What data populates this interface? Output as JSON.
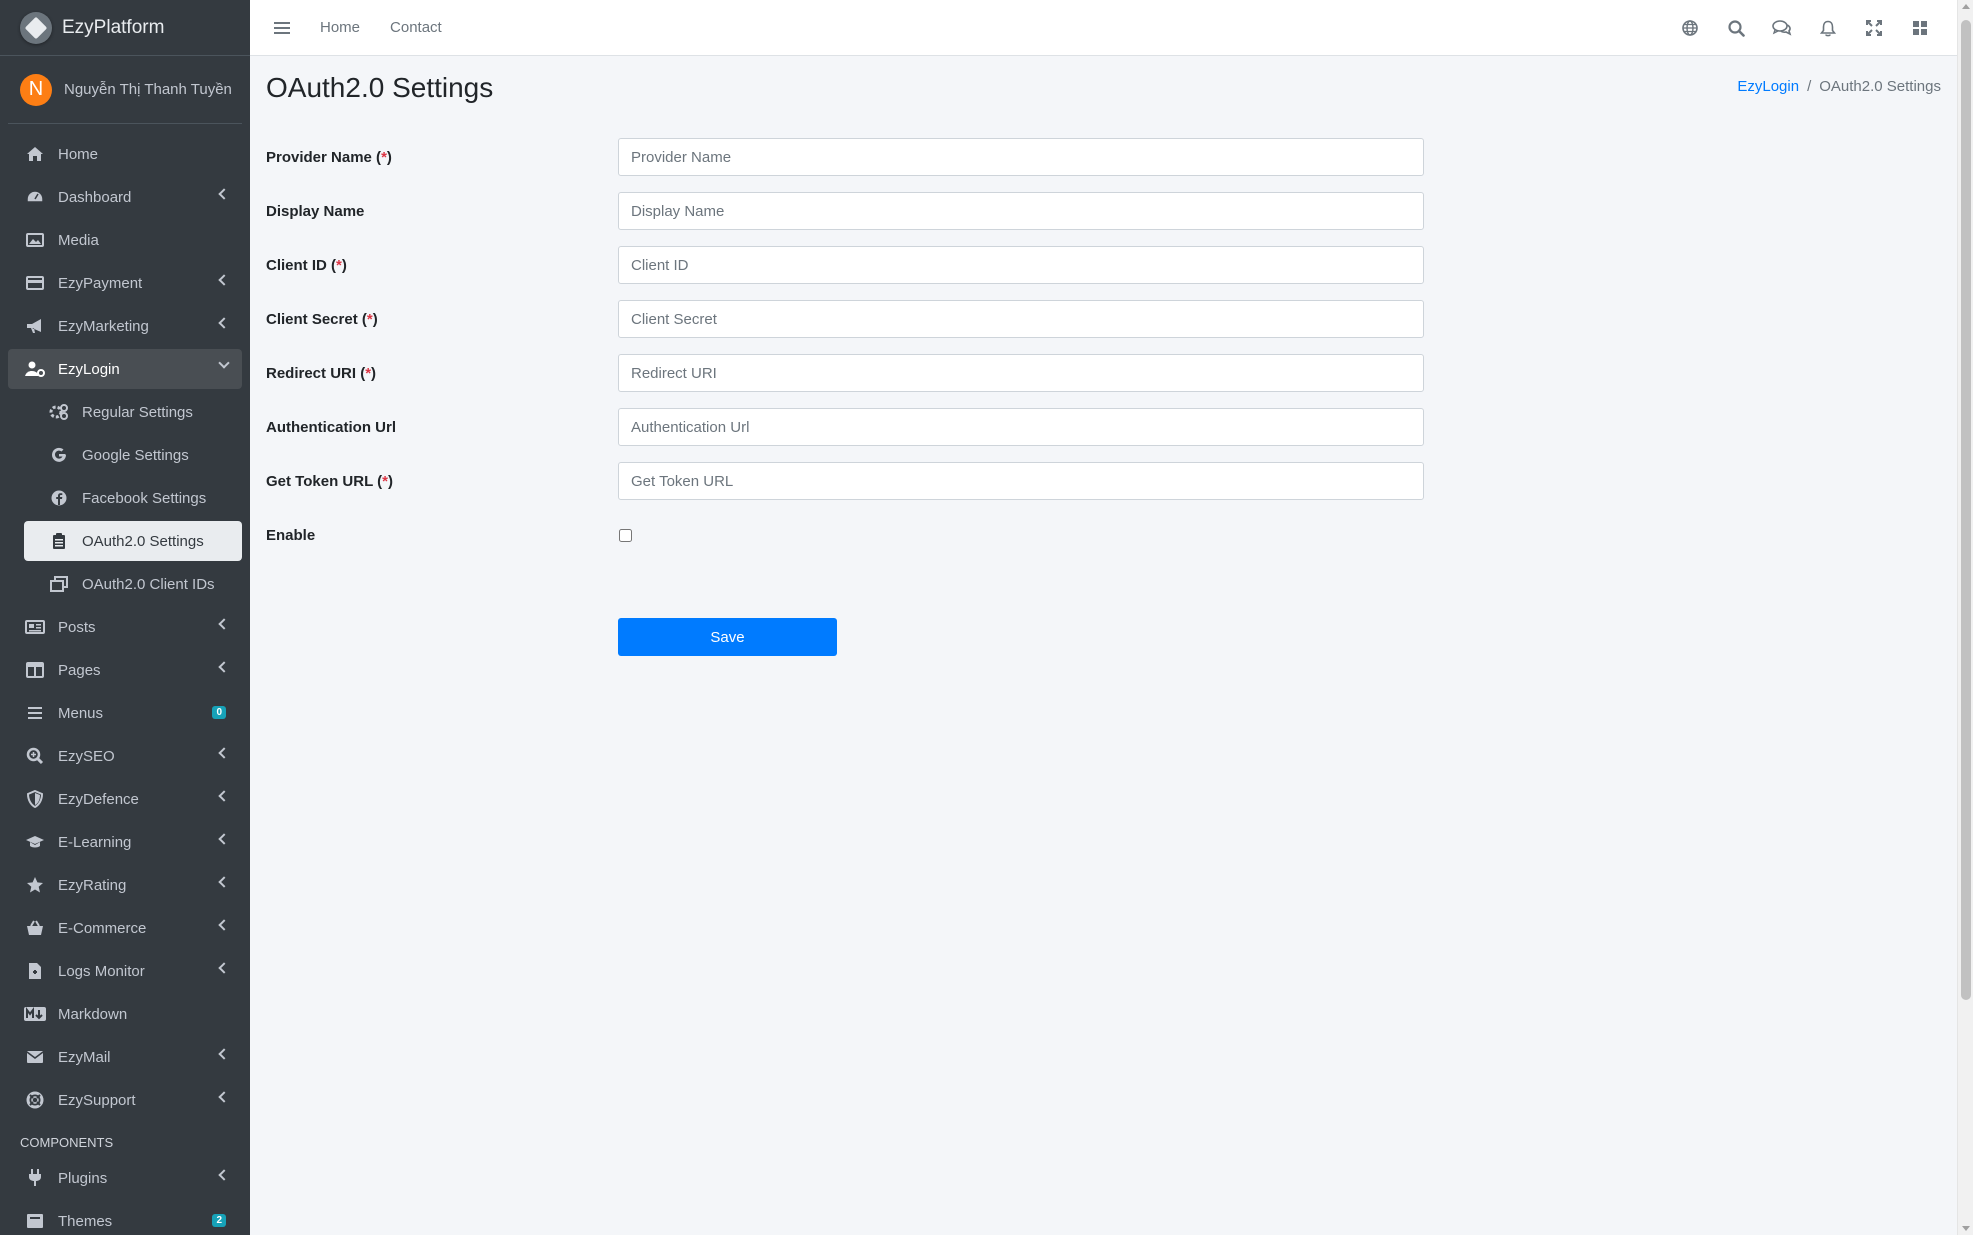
{
  "brand": {
    "name": "EzyPlatform"
  },
  "user": {
    "initial": "N",
    "name": "Nguyễn Thị Thanh Tuyền"
  },
  "sidebar": {
    "items": [
      {
        "label": "Home",
        "icon": "home-icon"
      },
      {
        "label": "Dashboard",
        "icon": "dashboard-icon"
      },
      {
        "label": "Media",
        "icon": "image-icon"
      },
      {
        "label": "EzyPayment",
        "icon": "credit-card-icon"
      },
      {
        "label": "EzyMarketing",
        "icon": "megaphone-icon"
      },
      {
        "label": "EzyLogin",
        "icon": "user-gear-icon"
      },
      {
        "label": "Posts",
        "icon": "newspaper-icon"
      },
      {
        "label": "Pages",
        "icon": "columns-icon"
      },
      {
        "label": "Menus",
        "icon": "bars-icon",
        "badge": "0"
      },
      {
        "label": "EzySEO",
        "icon": "search-plus-icon"
      },
      {
        "label": "EzyDefence",
        "icon": "shield-icon"
      },
      {
        "label": "E-Learning",
        "icon": "graduation-cap-icon"
      },
      {
        "label": "EzyRating",
        "icon": "star-icon"
      },
      {
        "label": "E-Commerce",
        "icon": "basket-icon"
      },
      {
        "label": "Logs Monitor",
        "icon": "file-medical-icon"
      },
      {
        "label": "Markdown",
        "icon": "markdown-icon"
      },
      {
        "label": "EzyMail",
        "icon": "envelope-icon"
      },
      {
        "label": "EzySupport",
        "icon": "life-ring-icon"
      }
    ],
    "ezylogin_children": [
      {
        "label": "Regular Settings",
        "icon": "cogs-icon"
      },
      {
        "label": "Google Settings",
        "icon": "google-icon"
      },
      {
        "label": "Facebook Settings",
        "icon": "facebook-icon"
      },
      {
        "label": "OAuth2.0 Settings",
        "icon": "clipboard-list-icon"
      },
      {
        "label": "OAuth2.0 Client IDs",
        "icon": "window-restore-icon"
      }
    ],
    "components_header": "COMPONENTS",
    "components": [
      {
        "label": "Plugins",
        "icon": "plug-icon"
      },
      {
        "label": "Themes",
        "icon": "theme-icon",
        "badge": "2"
      }
    ]
  },
  "topbar": {
    "links": [
      "Home",
      "Contact"
    ],
    "icons": [
      "globe-icon",
      "search-icon",
      "comments-icon",
      "bell-icon",
      "expand-icon",
      "grid-icon"
    ]
  },
  "page": {
    "title": "OAuth2.0 Settings",
    "breadcrumb": {
      "parent": "EzyLogin",
      "separator": "/",
      "current": "OAuth2.0 Settings"
    }
  },
  "form": {
    "required_mark": "*",
    "fields": [
      {
        "label": "Provider Name",
        "required": true,
        "placeholder": "Provider Name",
        "value": ""
      },
      {
        "label": "Display Name",
        "required": false,
        "placeholder": "Display Name",
        "value": ""
      },
      {
        "label": "Client ID",
        "required": true,
        "placeholder": "Client ID",
        "value": ""
      },
      {
        "label": "Client Secret",
        "required": true,
        "placeholder": "Client Secret",
        "value": ""
      },
      {
        "label": "Redirect URI",
        "required": true,
        "placeholder": "Redirect URI",
        "value": ""
      },
      {
        "label": "Authentication Url",
        "required": false,
        "placeholder": "Authentication Url",
        "value": ""
      },
      {
        "label": "Get Token URL",
        "required": true,
        "placeholder": "Get Token URL",
        "value": ""
      }
    ],
    "enable_label": "Enable",
    "enable_checked": false,
    "save_label": "Save"
  },
  "colors": {
    "sidebar_bg": "#343a40",
    "accent": "#007bff",
    "required": "#dc3545",
    "avatar": "#fd7e14",
    "badge": "#17a2b8"
  }
}
